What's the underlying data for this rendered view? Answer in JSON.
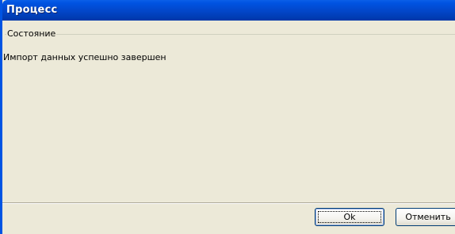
{
  "window": {
    "title": "Процесс"
  },
  "status_group": {
    "legend": "Состояние",
    "message": "Импорт данных успешно завершен"
  },
  "buttons": {
    "ok": "Ok",
    "cancel": "Отменить"
  },
  "colors": {
    "titlebar": "#0246c8",
    "dialog_background": "#ece9d8",
    "button_border": "#003c74"
  }
}
